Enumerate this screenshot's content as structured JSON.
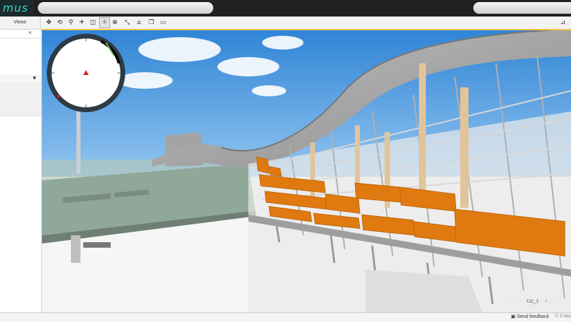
{
  "app": {
    "logo_text": "mus"
  },
  "toolbar": {
    "views_label": "Views",
    "tools": [
      {
        "name": "pan-tool-icon",
        "glyph": "✥"
      },
      {
        "name": "orbit-tool-icon",
        "glyph": "⟲"
      },
      {
        "name": "walk-tool-icon",
        "glyph": "⚲"
      },
      {
        "name": "fly-tool-icon",
        "glyph": "✈"
      },
      {
        "name": "camera-tool-icon",
        "glyph": "◫"
      },
      {
        "name": "fov-tool-icon",
        "glyph": "⌾"
      },
      {
        "name": "target-tool-icon",
        "glyph": "⊕"
      },
      {
        "name": "measure-tool-icon",
        "glyph": "⤡"
      },
      {
        "name": "home-tool-icon",
        "glyph": "⌂"
      },
      {
        "name": "bookmark-tool-icon",
        "glyph": "❐"
      },
      {
        "name": "ruler-tool-icon",
        "glyph": "▭"
      }
    ]
  },
  "sidebar": {
    "clear_glyph": "×",
    "filter_glyph": "▼"
  },
  "viewport": {
    "model_label": "T2C_3",
    "colors": {
      "sky": "#3b8fd9",
      "orange_panel": "#e07a10",
      "structure": "#c8c8c8",
      "glass": "#9ab4a8"
    }
  },
  "statusbar": {
    "feedback_label": "Send feedback",
    "copyright": "© Copy"
  }
}
